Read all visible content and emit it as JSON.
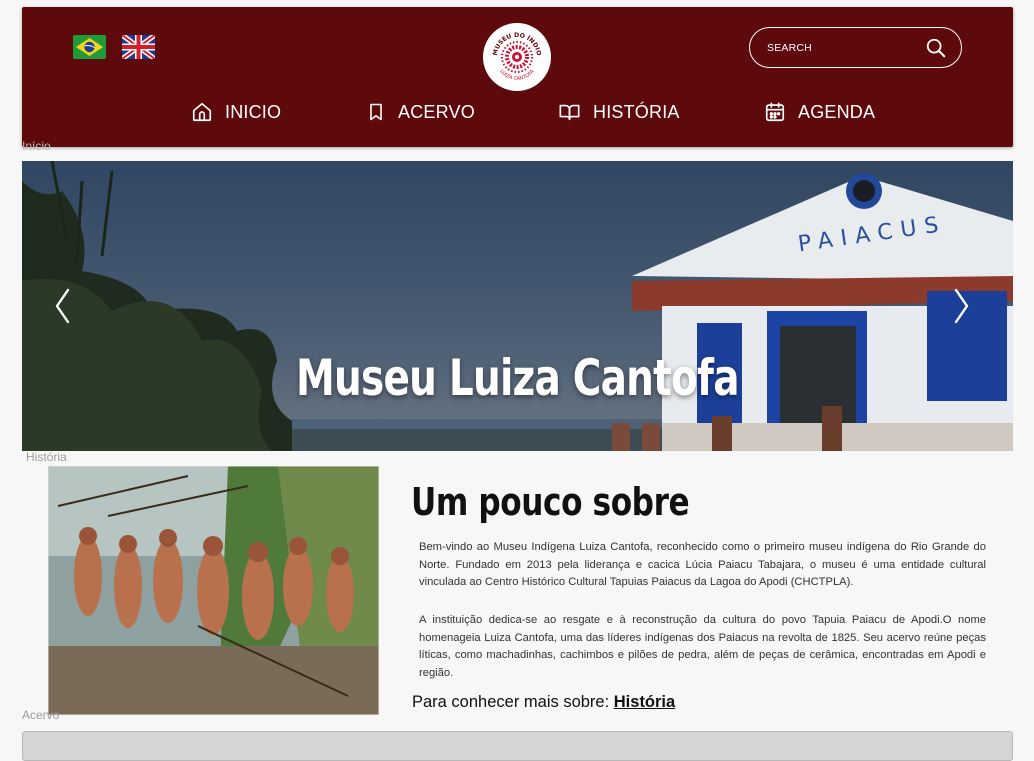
{
  "header": {
    "logo_text_top": "MUSEU DO ÍNDIO",
    "logo_text_bottom": "LUIZA CANTOFA",
    "search": {
      "placeholder": "SEARCH"
    },
    "nav": [
      {
        "label": "INICIO",
        "icon": "home-icon"
      },
      {
        "label": "ACERVO",
        "icon": "bookmark-icon"
      },
      {
        "label": "HISTÓRIA",
        "icon": "open-book-icon"
      },
      {
        "label": "AGENDA",
        "icon": "calendar-icon"
      }
    ],
    "flags": [
      "brazil-flag-icon",
      "uk-flag-icon"
    ]
  },
  "anchors": {
    "inicio": "Início",
    "historia": "História",
    "acervo": "Acervo"
  },
  "hero": {
    "title": "Museu Luiza Cantofa",
    "building_sign": "PAIACUS"
  },
  "about": {
    "title": "Um pouco sobre",
    "paragraph1": "Bem-vindo ao Museu Indígena Luiza Cantofa, reconhecido como o primeiro museu indígena do Rio Grande do Norte. Fundado em 2013 pela liderança e cacica Lúcia Paiacu Tabajara, o museu é uma entidade cultural vinculada ao Centro Histórico Cultural Tapuias Paiacus da Lagoa do Apodi (CHCTPLA).",
    "paragraph2": "A instituição dedica-se ao resgate e à reconstrução da cultura do povo Tapuia Paiacu de Apodi.O nome homenageia Luiza Cantofa, uma das líderes indígenas dos Paiacus na revolta de 1825. Seu acervo reúne peças líticas, como machadinhas, cachimbos e pilões de pedra, além de peças de cerâmica, encontradas em Apodi e região.",
    "more_prefix": "Para conhecer mais sobre: ",
    "more_link": "História"
  },
  "colors": {
    "header_bg": "#5e090c",
    "page_bg": "#f7f7f7",
    "text": "#333333"
  }
}
